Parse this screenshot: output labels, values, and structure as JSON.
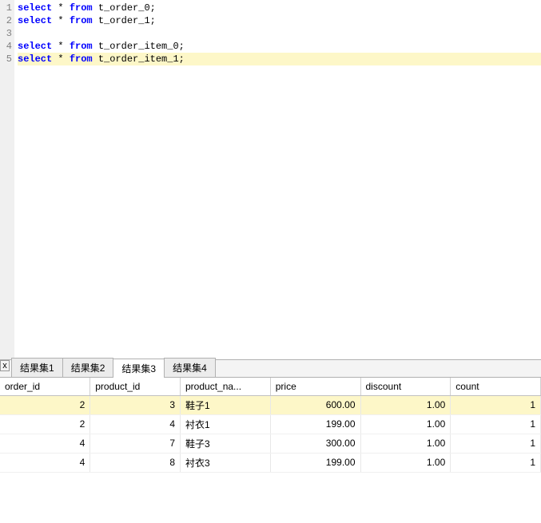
{
  "editor": {
    "lines": [
      {
        "n": 1,
        "parts": [
          {
            "t": "select",
            "c": "kw"
          },
          {
            "t": " * ",
            "c": "ident"
          },
          {
            "t": "from",
            "c": "kw"
          },
          {
            "t": " t_order_0;",
            "c": "ident"
          }
        ],
        "hl": false
      },
      {
        "n": 2,
        "parts": [
          {
            "t": "select",
            "c": "kw"
          },
          {
            "t": " * ",
            "c": "ident"
          },
          {
            "t": "from",
            "c": "kw"
          },
          {
            "t": " t_order_1;",
            "c": "ident"
          }
        ],
        "hl": false
      },
      {
        "n": 3,
        "parts": [],
        "hl": false
      },
      {
        "n": 4,
        "parts": [
          {
            "t": "select",
            "c": "kw"
          },
          {
            "t": " * ",
            "c": "ident"
          },
          {
            "t": "from",
            "c": "kw"
          },
          {
            "t": " t_order_item_0;",
            "c": "ident"
          }
        ],
        "hl": false
      },
      {
        "n": 5,
        "parts": [
          {
            "t": "select",
            "c": "kw"
          },
          {
            "t": " * ",
            "c": "ident"
          },
          {
            "t": "from",
            "c": "kw"
          },
          {
            "t": " t_order_item_1;",
            "c": "ident"
          }
        ],
        "hl": true
      }
    ]
  },
  "panel": {
    "close_label": "x",
    "tabs": [
      {
        "label": "结果集1",
        "active": false
      },
      {
        "label": "结果集2",
        "active": false
      },
      {
        "label": "结果集3",
        "active": true
      },
      {
        "label": "结果集4",
        "active": false
      }
    ],
    "columns": [
      "order_id",
      "product_id",
      "product_na...",
      "price",
      "discount",
      "count"
    ],
    "rows": [
      {
        "order_id": "2",
        "product_id": "3",
        "product_name": "鞋子1",
        "price": "600.00",
        "discount": "1.00",
        "count": "1",
        "selected": true
      },
      {
        "order_id": "2",
        "product_id": "4",
        "product_name": "衬衣1",
        "price": "199.00",
        "discount": "1.00",
        "count": "1",
        "selected": false
      },
      {
        "order_id": "4",
        "product_id": "7",
        "product_name": "鞋子3",
        "price": "300.00",
        "discount": "1.00",
        "count": "1",
        "selected": false
      },
      {
        "order_id": "4",
        "product_id": "8",
        "product_name": "衬衣3",
        "price": "199.00",
        "discount": "1.00",
        "count": "1",
        "selected": false
      }
    ]
  }
}
